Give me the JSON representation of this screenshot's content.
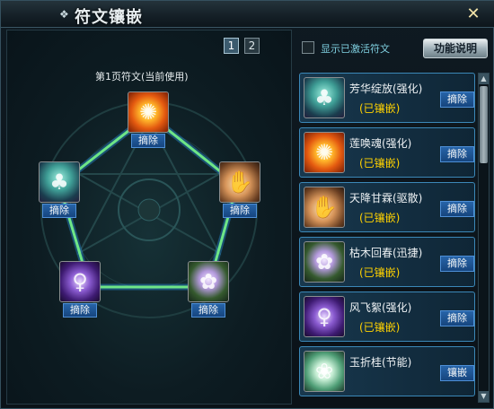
{
  "window": {
    "title": "符文镶嵌",
    "title_deco_icon": "diamond-ornament-icon",
    "close_icon": "close-icon"
  },
  "left": {
    "pages": [
      "1",
      "2"
    ],
    "active_page": "1",
    "page_label": "第1页符文(当前使用)",
    "remove_label": "摘除",
    "slots": [
      {
        "name": "slot-top",
        "icon": "lotus-icon"
      },
      {
        "name": "slot-left",
        "icon": "tree-icon"
      },
      {
        "name": "slot-right",
        "icon": "hand-icon"
      },
      {
        "name": "slot-bottom-left",
        "icon": "spirit-icon"
      },
      {
        "name": "slot-bottom-right",
        "icon": "blossom-icon"
      }
    ]
  },
  "right": {
    "show_active_label": "显示已激活符文",
    "help_label": "功能说明",
    "runes": [
      {
        "name": "芳华绽放(强化)",
        "status": "(已镶嵌)",
        "button": "摘除",
        "icon": "tree-icon"
      },
      {
        "name": "莲唤魂(强化)",
        "status": "(已镶嵌)",
        "button": "摘除",
        "icon": "lotus-icon"
      },
      {
        "name": "天降甘霖(驱散)",
        "status": "(已镶嵌)",
        "button": "摘除",
        "icon": "hand-icon"
      },
      {
        "name": "枯木回春(迅捷)",
        "status": "(已镶嵌)",
        "button": "摘除",
        "icon": "blossom-icon"
      },
      {
        "name": "风飞絮(强化)",
        "status": "(已镶嵌)",
        "button": "摘除",
        "icon": "spirit-icon"
      },
      {
        "name": "玉折桂(节能)",
        "status": "",
        "button": "镶嵌",
        "icon": "leaf-icon"
      }
    ]
  }
}
